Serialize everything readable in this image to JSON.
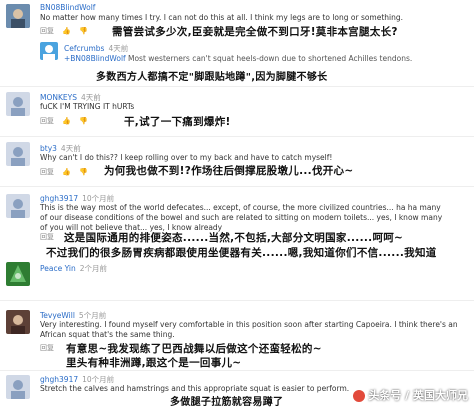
{
  "comments": [
    {
      "user": "BN08BlindWolf",
      "time": "",
      "text": "No matter how many times I try. I can not do this at all. I think my legs are to long or something.",
      "reply": "回复",
      "zh": "需管尝试多少次,臣妾就是完全做不到口牙!莫非本宫腿太长?"
    },
    {
      "user": "Cefcrumbs",
      "time": "4天前",
      "quote_user": "+BN08BlindWolf",
      "quote_text": "Most westerners can't squat heels-down due to shortened Achilles tendons.",
      "zh": "多数西方人都搞不定\"脚跟贴地蹲\",因为脚腱不够长"
    },
    {
      "user": "MONKEYS",
      "time": "4天前",
      "text": "fuCK I'M TRYING IT hURTs",
      "reply": "回复",
      "zh": "干,试了一下痛到爆炸!"
    },
    {
      "user": "bty3",
      "time": "4天前",
      "text": "Why can't I do this?? I keep rolling over to my back and have to catch myself!",
      "reply": "回复",
      "zh": "为何我也做不到!?作场往后倒撑屁股墩儿...伐开心~"
    },
    {
      "user": "ghgh3917",
      "time": "10个月前",
      "text": "This is the way most of the world defecates... except, of course, the more civilized countries... ha ha many of our disease conditions of the bowel and such are related to sitting on modern toilets... yes, I know many of you will not believe that... yes, I know already",
      "reply": "回复",
      "zh1": "这是国际通用的排便姿态......当然,不包括,大部分文明国家......呵呵~",
      "zh2": "不过我们的很多肠胃疾病都跟使用坐便器有关......嗯,我知道你们不信......我知道"
    },
    {
      "user": "Peace Yin",
      "time": "2个月前",
      "text": ""
    },
    {
      "user": "TevyeWill",
      "time": "5个月前",
      "text": "Very interesting. I found myself very comfortable in this position soon after starting Capoeira. I think there's an African squat that's the same thing.",
      "reply": "回复",
      "zh1": "有意思~我发现练了巴西战舞以后做这个还蛮轻松的~",
      "zh2": "里头有种非洲蹲,跟这个是一回事儿~"
    },
    {
      "user": "ghgh3917",
      "time": "10个月前",
      "text": "Stretch the calves and hamstrings and this appropriate squat is easier to perform.",
      "zh": "多做腿子拉筋就容易蹲了"
    }
  ],
  "watermark": "头条号 / 英国大师兄"
}
